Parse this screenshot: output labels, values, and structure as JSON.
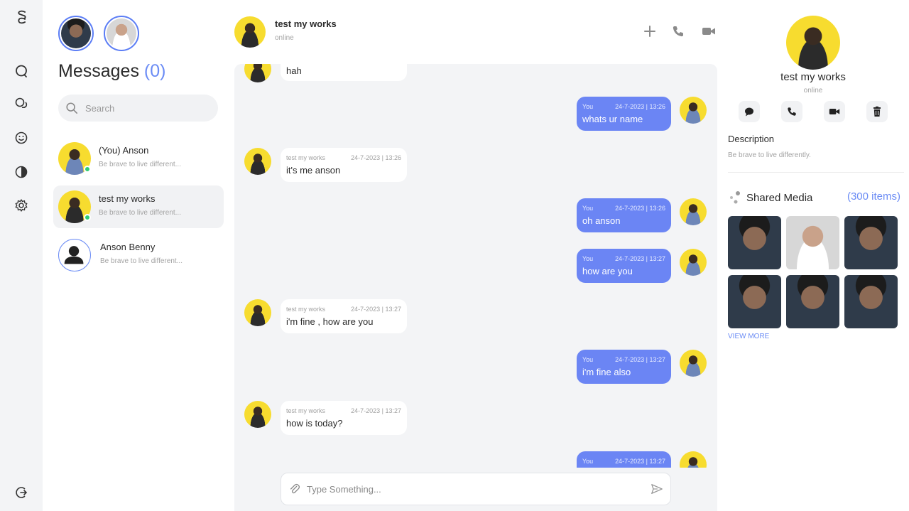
{
  "app": {
    "logo": "SC"
  },
  "rail": {
    "items": [
      "chat-icon",
      "chats-icon",
      "emoji-icon",
      "theme-icon",
      "settings-icon"
    ],
    "logout": "logout-icon"
  },
  "contacts": {
    "title": "Messages",
    "count": "(0)",
    "search_placeholder": "Search",
    "items": [
      {
        "name": "(You) Anson",
        "preview": "Be brave to live different...",
        "online": true
      },
      {
        "name": "test my works",
        "preview": "Be brave to live different...",
        "online": true
      },
      {
        "name": "Anson Benny",
        "preview": "Be brave to live different...",
        "online": false
      }
    ]
  },
  "chat": {
    "header": {
      "name": "test my works",
      "status": "online"
    },
    "messages": [
      {
        "dir": "in",
        "sender": "",
        "time": "",
        "text": "hah"
      },
      {
        "dir": "out",
        "sender": "You",
        "time": "24-7-2023 | 13:26",
        "text": "whats ur name"
      },
      {
        "dir": "in",
        "sender": "test my works",
        "time": "24-7-2023 | 13:26",
        "text": "it's me anson"
      },
      {
        "dir": "out",
        "sender": "You",
        "time": "24-7-2023 | 13:26",
        "text": "oh anson"
      },
      {
        "dir": "out",
        "sender": "You",
        "time": "24-7-2023 | 13:27",
        "text": "how are you"
      },
      {
        "dir": "in",
        "sender": "test my works",
        "time": "24-7-2023 | 13:27",
        "text": "i'm fine , how are you"
      },
      {
        "dir": "out",
        "sender": "You",
        "time": "24-7-2023 | 13:27",
        "text": "i'm fine also"
      },
      {
        "dir": "in",
        "sender": "test my works",
        "time": "24-7-2023 | 13:27",
        "text": "how is today?"
      },
      {
        "dir": "out",
        "sender": "You",
        "time": "24-7-2023 | 13:27",
        "text": ""
      }
    ],
    "composer_placeholder": "Type Something..."
  },
  "details": {
    "name": "test my works",
    "status": "online",
    "description_title": "Description",
    "description": "Be brave to live differently.",
    "shared_media_title": "Shared Media",
    "shared_media_count": "(300 items)",
    "view_more": "VIEW MORE"
  },
  "colors": {
    "accent": "#6b85f4",
    "online": "#2ecc71",
    "avatar_bg": "#f7dc2f"
  }
}
